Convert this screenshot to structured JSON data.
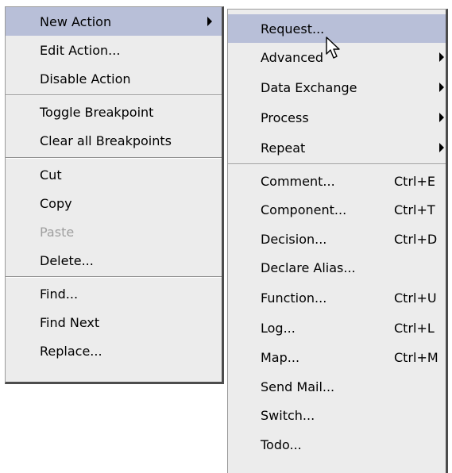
{
  "context_menu": {
    "items": [
      {
        "label": "New Action",
        "has_submenu": true
      },
      {
        "label": "Edit Action..."
      },
      {
        "label": "Disable Action"
      },
      {
        "label": "Toggle Breakpoint"
      },
      {
        "label": "Clear all Breakpoints"
      },
      {
        "label": "Cut"
      },
      {
        "label": "Copy"
      },
      {
        "label": "Paste",
        "disabled": true
      },
      {
        "label": "Delete..."
      },
      {
        "label": "Find..."
      },
      {
        "label": "Find Next"
      },
      {
        "label": "Replace..."
      }
    ]
  },
  "submenu": {
    "items": [
      {
        "label": "Request..."
      },
      {
        "label": "Advanced",
        "has_submenu": true
      },
      {
        "label": "Data Exchange",
        "has_submenu": true
      },
      {
        "label": "Process",
        "has_submenu": true
      },
      {
        "label": "Repeat",
        "has_submenu": true
      },
      {
        "label": "Comment...",
        "shortcut": "Ctrl+E"
      },
      {
        "label": "Component...",
        "shortcut": "Ctrl+T"
      },
      {
        "label": "Decision...",
        "shortcut": "Ctrl+D"
      },
      {
        "label": "Declare Alias..."
      },
      {
        "label": "Function...",
        "shortcut": "Ctrl+U"
      },
      {
        "label": "Log...",
        "shortcut": "Ctrl+L"
      },
      {
        "label": "Map...",
        "shortcut": "Ctrl+M"
      },
      {
        "label": "Send Mail..."
      },
      {
        "label": "Switch..."
      },
      {
        "label": "Todo..."
      }
    ]
  },
  "colors": {
    "menu_bg": "#ececec",
    "highlight": "#b8bfd8",
    "disabled_text": "#9f9f9f"
  },
  "icons": {
    "submenu": "arrow-right-icon",
    "pointer": "mouse-pointer-icon"
  }
}
